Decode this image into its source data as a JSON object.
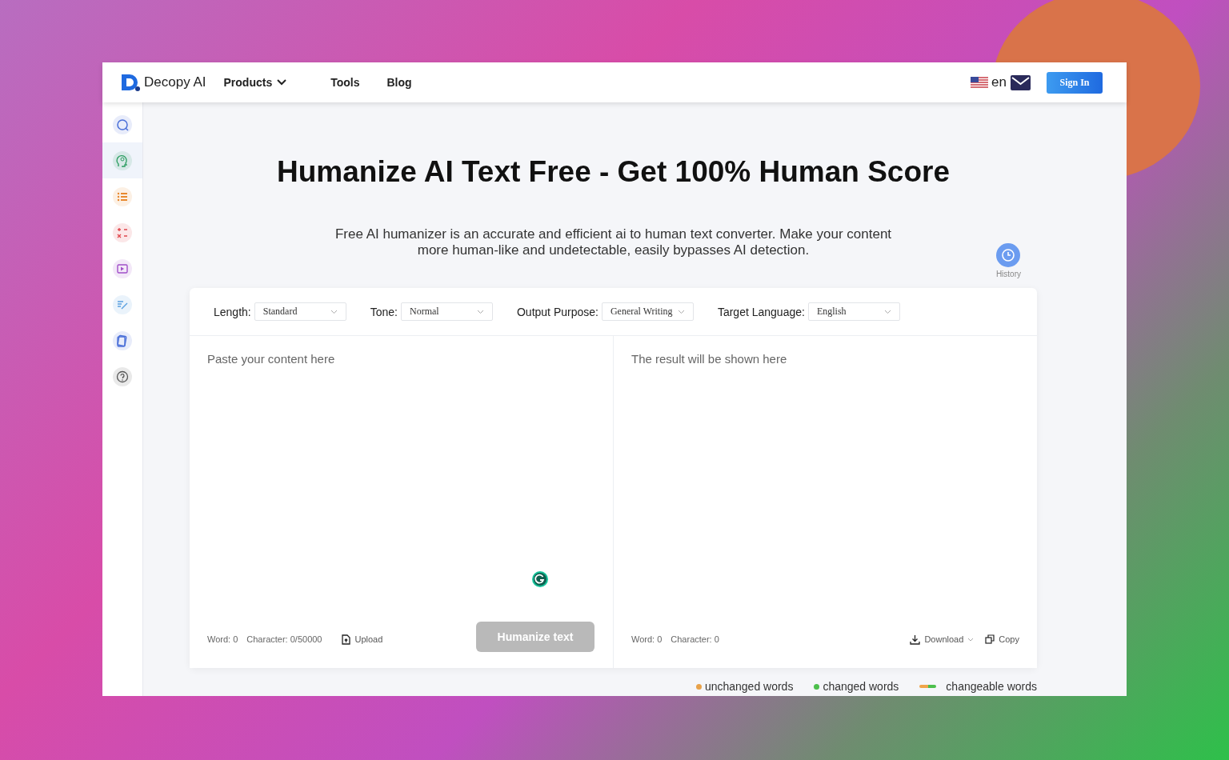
{
  "header": {
    "brand": "Decopy AI",
    "nav": [
      {
        "label": "Products",
        "dropdown": true
      },
      {
        "label": "Tools",
        "dropdown": false
      },
      {
        "label": "Blog",
        "dropdown": false
      }
    ],
    "language": "en",
    "sign_in": "Sign In"
  },
  "sidebar": {
    "items": [
      {
        "kind": "ai-search",
        "selected": false
      },
      {
        "kind": "head",
        "selected": true
      },
      {
        "kind": "list",
        "selected": false
      },
      {
        "kind": "math",
        "selected": false
      },
      {
        "kind": "video",
        "selected": false
      },
      {
        "kind": "edit",
        "selected": false
      },
      {
        "kind": "cards",
        "selected": false
      },
      {
        "kind": "help",
        "selected": false
      }
    ]
  },
  "title": "Humanize AI Text Free - Get 100% Human Score",
  "subtitle": "Free AI humanizer is an accurate and efficient ai to human text converter. Make your content more human-like and undetectable, easily bypasses AI detection.",
  "history": "History",
  "options": [
    {
      "label": "Length:",
      "value": "Standard"
    },
    {
      "label": "Tone:",
      "value": "Normal"
    },
    {
      "label": "Output Purpose:",
      "value": "General Writing"
    },
    {
      "label": "Target Language:",
      "value": "English"
    }
  ],
  "input": {
    "placeholder": "Paste your content here",
    "word_count": "Word: 0",
    "char_count": "Character: 0/50000",
    "upload": "Upload",
    "submit": {
      "label": "Humanize text",
      "disabled": true
    }
  },
  "output": {
    "placeholder": "The result will be shown here",
    "word_count": "Word: 0",
    "char_count": "Character: 0",
    "download": "Download",
    "copy": "Copy"
  },
  "legend": [
    {
      "kind": "dot",
      "label": "unchanged words",
      "color": "#e8a24a"
    },
    {
      "kind": "dot",
      "label": "changed words",
      "color": "#4cbf4c"
    },
    {
      "kind": "line",
      "label": "changeable words",
      "color": "#f0a54a"
    }
  ]
}
